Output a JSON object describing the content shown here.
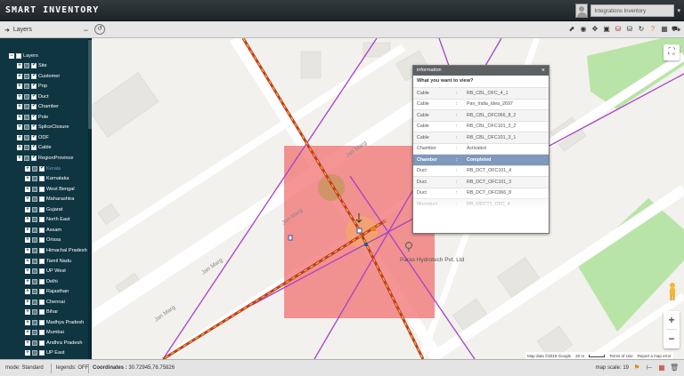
{
  "app": {
    "title": "SMART INVENTORY",
    "user_name": "Integrations Inventory",
    "user_menu": "▾"
  },
  "toolbar": {
    "layers_label": "Layers",
    "tools": [
      {
        "name": "cursor-icon",
        "glyph": "⬈"
      },
      {
        "name": "locate-icon",
        "glyph": "◉"
      },
      {
        "name": "move-icon",
        "glyph": "✥"
      },
      {
        "name": "layers-icon",
        "glyph": "▣"
      },
      {
        "name": "database-red-icon",
        "glyph": "⛁"
      },
      {
        "name": "database-dark-icon",
        "glyph": "⛁"
      },
      {
        "name": "refresh-icon",
        "glyph": "↻"
      },
      {
        "name": "help-icon",
        "glyph": "?"
      },
      {
        "name": "grid-icon",
        "glyph": "▦"
      },
      {
        "name": "truck-icon",
        "glyph": "⛟"
      }
    ]
  },
  "sidebar": {
    "items": [
      {
        "label": "Layers",
        "level": 0,
        "exp": true,
        "checked": false
      },
      {
        "label": "Site",
        "level": 1,
        "exp": true,
        "checked": true
      },
      {
        "label": "Customer",
        "level": 1,
        "exp": true,
        "checked": true
      },
      {
        "label": "Pop",
        "level": 1,
        "exp": true,
        "checked": true
      },
      {
        "label": "Duct",
        "level": 1,
        "exp": true,
        "checked": true
      },
      {
        "label": "Chamber",
        "level": 1,
        "exp": true,
        "checked": true
      },
      {
        "label": "Pole",
        "level": 1,
        "exp": true,
        "checked": true
      },
      {
        "label": "SpliceClosure",
        "level": 1,
        "exp": true,
        "checked": true
      },
      {
        "label": "ODF",
        "level": 1,
        "exp": true,
        "checked": true
      },
      {
        "label": "Cable",
        "level": 1,
        "exp": true,
        "checked": true
      },
      {
        "label": "RegionProvince",
        "level": 1,
        "exp": true,
        "checked": true
      },
      {
        "label": "Kerala",
        "level": 2,
        "exp": true,
        "checked": true
      },
      {
        "label": "Karnataka",
        "level": 2,
        "exp": true,
        "checked": false
      },
      {
        "label": "West Bengal",
        "level": 2,
        "exp": true,
        "checked": false
      },
      {
        "label": "Maharashtra",
        "level": 2,
        "exp": true,
        "checked": false
      },
      {
        "label": "Gujarat",
        "level": 2,
        "exp": true,
        "checked": false
      },
      {
        "label": "North East",
        "level": 2,
        "exp": true,
        "checked": false
      },
      {
        "label": "Assam",
        "level": 2,
        "exp": true,
        "checked": false
      },
      {
        "label": "Orissa",
        "level": 2,
        "exp": true,
        "checked": false
      },
      {
        "label": "Himachal Pradesh",
        "level": 2,
        "exp": true,
        "checked": false
      },
      {
        "label": "Tamil Nadu",
        "level": 2,
        "exp": true,
        "checked": false
      },
      {
        "label": "UP West",
        "level": 2,
        "exp": true,
        "checked": false
      },
      {
        "label": "Delhi",
        "level": 2,
        "exp": true,
        "checked": false
      },
      {
        "label": "Rajasthan",
        "level": 2,
        "exp": true,
        "checked": false
      },
      {
        "label": "Chennai",
        "level": 2,
        "exp": true,
        "checked": false
      },
      {
        "label": "Bihar",
        "level": 2,
        "exp": true,
        "checked": false
      },
      {
        "label": "Madhya Pradesh",
        "level": 2,
        "exp": true,
        "checked": false
      },
      {
        "label": "Mumbai",
        "level": 2,
        "exp": true,
        "checked": false
      },
      {
        "label": "Andhra Pradesh",
        "level": 2,
        "exp": true,
        "checked": false
      },
      {
        "label": "UP East",
        "level": 2,
        "exp": true,
        "checked": false
      }
    ]
  },
  "map": {
    "road_label_1": "Jan Marg",
    "road_label_2": "Jan Marg",
    "road_label_3": "Jan Marg",
    "road_label_4": "Jan Marg",
    "poi_label": "Paras Hydrotech Pvt. Ltd",
    "attribution": {
      "data": "Map data ©2019 Google",
      "scale": "20 m",
      "terms": "Terms of Use",
      "report": "Report a map error"
    },
    "zoom_in": "+",
    "zoom_out": "−",
    "fullscreen": "⛶"
  },
  "info": {
    "title": "information",
    "close": "×",
    "question": "What you want to view?",
    "rows": [
      {
        "type": "Cable",
        "sep": ":",
        "value": "RB_CBL_OFC_4_1",
        "selected": false
      },
      {
        "type": "Cable",
        "sep": ":",
        "value": "Pan_India_Idea_2697",
        "selected": false
      },
      {
        "type": "Cable",
        "sep": ":",
        "value": "RB_CBL_OFC066_8_2",
        "selected": false
      },
      {
        "type": "Cable",
        "sep": ":",
        "value": "RB_CBL_OFC101_3_2",
        "selected": false
      },
      {
        "type": "Cable",
        "sep": ":",
        "value": "RB_CBL_OFC101_3_1",
        "selected": false
      },
      {
        "type": "Chamber",
        "sep": ":",
        "value": "Activated",
        "selected": false
      },
      {
        "type": "Chamber",
        "sep": ":",
        "value": "Completed",
        "selected": true
      },
      {
        "type": "Duct",
        "sep": ":",
        "value": "RB_DCT_OFC101_4",
        "selected": false
      },
      {
        "type": "Duct",
        "sep": ":",
        "value": "RB_DCT_OFC101_3",
        "selected": false
      },
      {
        "type": "Duct",
        "sep": ":",
        "value": "RB_DCT_OFC066_8",
        "selected": false
      },
      {
        "type": "Microduct",
        "sep": ":",
        "value": "RB_MDCT1_OFC_4",
        "selected": false
      }
    ]
  },
  "status": {
    "mode_label": "mode:",
    "mode_value": "Standard",
    "legends_label": "legends:",
    "legends_value": "OFF",
    "coords_label": "Coordinates :",
    "coords_value": "30.72945,76.75826",
    "scale_label": "map scale:",
    "scale_value": "19"
  },
  "colors": {
    "sidebar_bg": "#0f3541",
    "selected_row": "#7f98bb",
    "overlay": "#f26d6d",
    "cable": "#c0392b",
    "duct": "#a040c0"
  }
}
